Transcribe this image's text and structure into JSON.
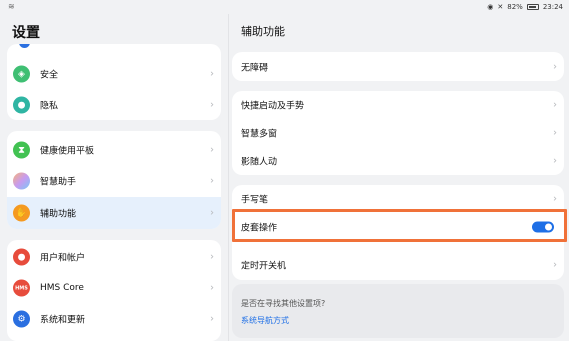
{
  "status": {
    "left_icon": "wifi-icon",
    "battery_text": "82%",
    "time": "23:24"
  },
  "left": {
    "title": "设置",
    "groups": [
      {
        "items": [
          {
            "label": "安全",
            "icon": "shield-icon",
            "color": "#3fbf73"
          },
          {
            "label": "隐私",
            "icon": "privacy-icon",
            "color": "#2fb5a3"
          }
        ]
      },
      {
        "items": [
          {
            "label": "健康使用平板",
            "icon": "hourglass-icon",
            "color": "#42c252"
          },
          {
            "label": "智慧助手",
            "icon": "assistant-icon",
            "color": "#c79bf0"
          },
          {
            "label": "辅助功能",
            "icon": "hand-icon",
            "color": "#f59a21",
            "selected": true
          }
        ]
      },
      {
        "items": [
          {
            "label": "用户和帐户",
            "icon": "user-icon",
            "color": "#e74c3c"
          },
          {
            "label": "HMS Core",
            "icon": "hms-icon",
            "color": "#e74c3c",
            "icon_text": "HMS"
          },
          {
            "label": "系统和更新",
            "icon": "gear-icon",
            "color": "#2a6fe0"
          }
        ]
      }
    ]
  },
  "right": {
    "title": "辅助功能",
    "cards": [
      {
        "items": [
          {
            "label": "无障碍"
          }
        ]
      },
      {
        "items": [
          {
            "label": "快捷启动及手势"
          },
          {
            "label": "智慧多窗"
          },
          {
            "label": "影随人动"
          }
        ]
      },
      {
        "items": [
          {
            "label": "手写笔"
          },
          {
            "label": "皮套操作",
            "toggle": true
          },
          {
            "label": "定时开关机"
          }
        ]
      }
    ],
    "suggest": {
      "question": "是否在寻找其他设置项?",
      "link": "系统导航方式"
    }
  },
  "colors": {
    "accent": "#1e6fe6",
    "highlight": "#f07139",
    "selected_bg": "#e6f0fc"
  }
}
